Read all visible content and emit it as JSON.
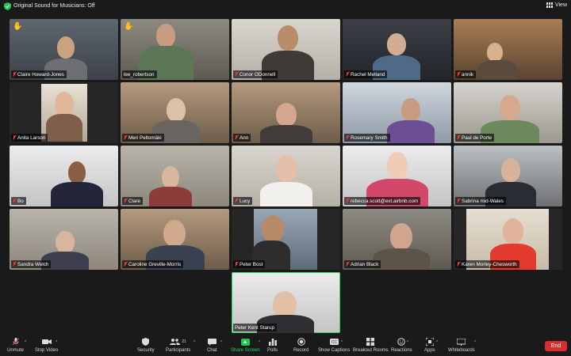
{
  "topbar": {
    "title": "Original Sound for Musicians: Off",
    "view_label": "View"
  },
  "participants": [
    {
      "name": "Claire Howard-Jones",
      "muted": true,
      "hand": true
    },
    {
      "name": "lee_robertson",
      "muted": false,
      "hand": true
    },
    {
      "name": "Conor ODonnell",
      "muted": true,
      "hand": false
    },
    {
      "name": "Rachel Melland",
      "muted": true,
      "hand": false
    },
    {
      "name": "annik",
      "muted": true,
      "hand": false
    },
    {
      "name": "Anita Larson",
      "muted": true,
      "hand": false
    },
    {
      "name": "Meri Peltomäki",
      "muted": true,
      "hand": false
    },
    {
      "name": "Ann",
      "muted": true,
      "hand": false
    },
    {
      "name": "Rosemary Smith",
      "muted": true,
      "hand": false
    },
    {
      "name": "Paul de Porte",
      "muted": true,
      "hand": false
    },
    {
      "name": "Bo",
      "muted": true,
      "hand": false
    },
    {
      "name": "Clare",
      "muted": true,
      "hand": false
    },
    {
      "name": "Lucy",
      "muted": true,
      "hand": false
    },
    {
      "name": "rebecca.scott@ext.airbnb.com",
      "muted": true,
      "hand": false
    },
    {
      "name": "Sabrina mid-Wales",
      "muted": true,
      "hand": false
    },
    {
      "name": "Sandra Welch",
      "muted": true,
      "hand": false
    },
    {
      "name": "Caroline Greville-Morris",
      "muted": true,
      "hand": false
    },
    {
      "name": "Peter Bost",
      "muted": true,
      "hand": false
    },
    {
      "name": "Adrian Black",
      "muted": true,
      "hand": false
    },
    {
      "name": "Karen Morley-Chesworth",
      "muted": true,
      "hand": false
    },
    {
      "name": "Peter Kent Starup",
      "muted": false,
      "hand": false,
      "active_speaker": true
    }
  ],
  "toolbar": {
    "unmute": "Unmute",
    "stop_video": "Stop Video",
    "security": "Security",
    "participants": "Participants",
    "participants_count": "21",
    "chat": "Chat",
    "share_screen": "Share Screen",
    "polls": "Polls",
    "record": "Record",
    "show_captions": "Show Captions",
    "breakout_rooms": "Breakout Rooms",
    "reactions": "Reactions",
    "apps": "Apps",
    "whiteboards": "Whiteboards",
    "end": "End"
  },
  "colors": {
    "accent_green": "#23d959",
    "end_red": "#d92d2d",
    "muted_red": "#e83c3c",
    "background": "#1a1a1a"
  },
  "icons": {
    "shield": "shield-check-icon",
    "view": "grid-view-icon",
    "hand": "raised-hand-icon",
    "mic": "mic-muted-icon"
  }
}
